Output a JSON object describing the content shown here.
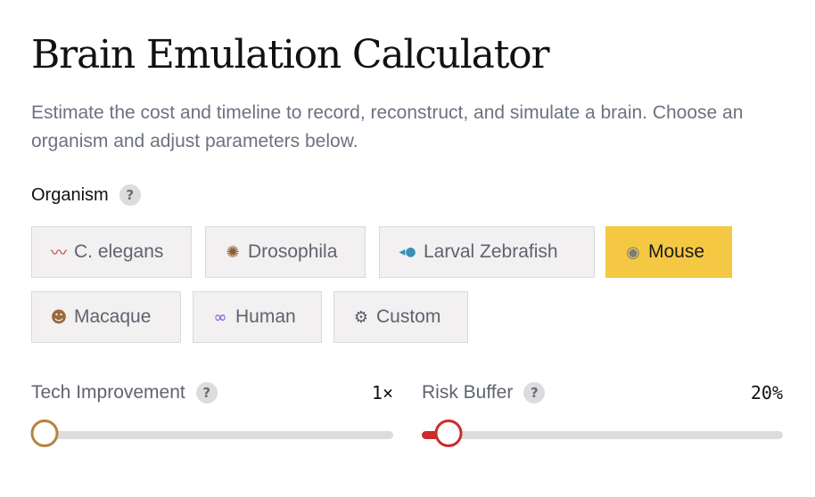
{
  "header": {
    "title": "Brain Emulation Calculator",
    "subtitle": "Estimate the cost and timeline to record, reconstruct, and simulate a brain. Choose an organism and adjust parameters below."
  },
  "organism": {
    "label": "Organism",
    "help": "?",
    "selected": "Mouse",
    "options": [
      {
        "label": "C. elegans",
        "icon": "worm-icon",
        "glyph": "〰"
      },
      {
        "label": "Drosophila",
        "icon": "fly-icon",
        "glyph": "✺"
      },
      {
        "label": "Larval Zebrafish",
        "icon": "fish-icon",
        "glyph": "◂●"
      },
      {
        "label": "Mouse",
        "icon": "mouse-icon",
        "glyph": "◉"
      },
      {
        "label": "Macaque",
        "icon": "monkey-icon",
        "glyph": "☻"
      },
      {
        "label": "Human",
        "icon": "dna-icon",
        "glyph": "∞"
      },
      {
        "label": "Custom",
        "icon": "gear-icon",
        "glyph": "⚙"
      }
    ]
  },
  "sliders": {
    "tech_improvement": {
      "label": "Tech Improvement",
      "help": "?",
      "value_text": "1×",
      "value": 1,
      "fraction": 0.0
    },
    "risk_buffer": {
      "label": "Risk Buffer",
      "help": "?",
      "value_text": "20%",
      "value": 20,
      "fraction": 0.04
    }
  },
  "colors": {
    "selected_bg": "#f4c842",
    "tech_thumb_border": "#b7823f",
    "risk_thumb_border": "#cc2b2b"
  }
}
